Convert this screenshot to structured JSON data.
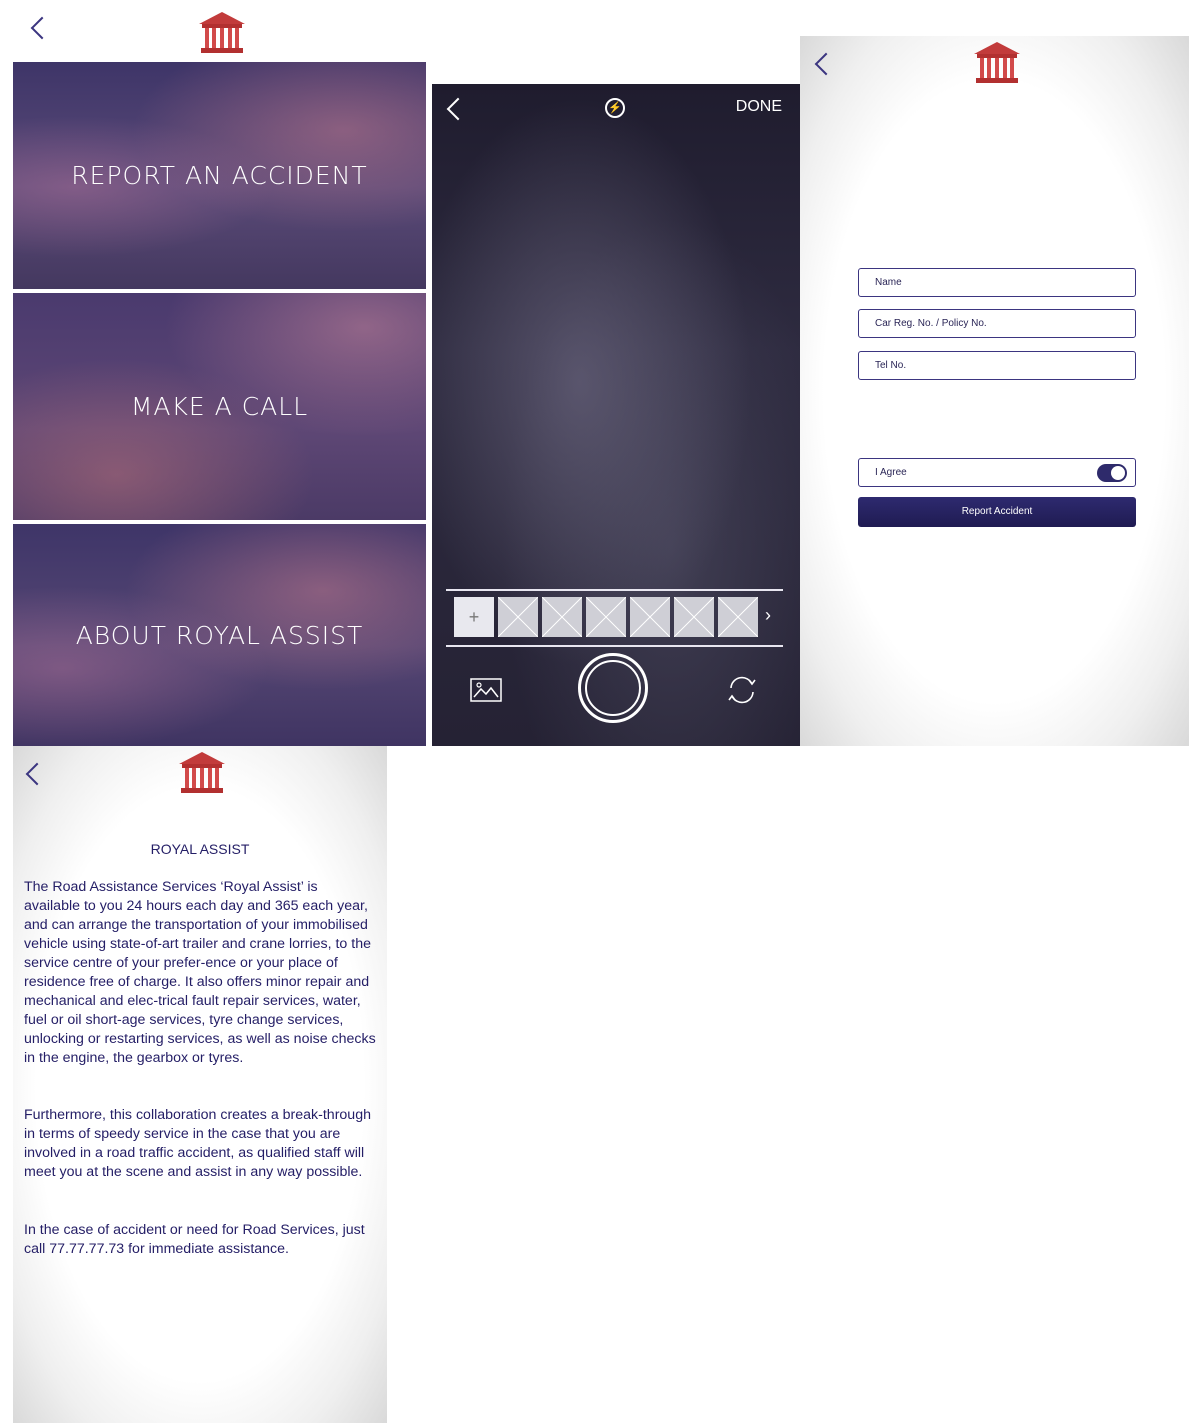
{
  "colors": {
    "brand_navy": "#241e66",
    "accent_red": "#c23b3b",
    "button": "#1f1b52"
  },
  "menu": {
    "items": [
      {
        "label": "REPORT AN ACCIDENT"
      },
      {
        "label": "MAKE A CALL"
      },
      {
        "label": "ABOUT ROYAL ASSIST"
      }
    ]
  },
  "camera": {
    "done_label": "DONE",
    "add_thumb": "+",
    "thumb_count": 6,
    "more_arrow": "›",
    "icons": [
      "back-icon",
      "flash-icon",
      "gallery-icon",
      "shutter-button",
      "switch-camera-icon"
    ]
  },
  "form": {
    "name_placeholder": "Name",
    "car_placeholder": "Car Reg. No. / Policy No.",
    "tel_placeholder": "Tel No.",
    "agree_label": "I Agree",
    "agree_on": true,
    "submit_label": "Report Accident"
  },
  "about": {
    "title": "ROYAL ASSIST",
    "p1": "The Road Assistance Services ‘Royal Assist’ is available to you 24 hours each day and 365 each year, and can arrange the transportation of your immobilised vehicle using state-of-art trailer and crane lorries, to the service centre of your prefer-ence or your place of residence free of charge. It also offers minor repair and mechanical and elec-trical fault repair services, water, fuel or oil short-age services, tyre change services, unlocking or restarting services, as well as noise checks in the engine, the gearbox or tyres.",
    "p2": "Furthermore, this collaboration creates a break-through in terms of speedy service in the case that you are involved in a road traffic accident, as qualified staff will meet you at the scene and assist in any way possible.",
    "p3": "In the case of accident or need for Road Services, just call 77.77.77.73 for immediate assistance."
  }
}
